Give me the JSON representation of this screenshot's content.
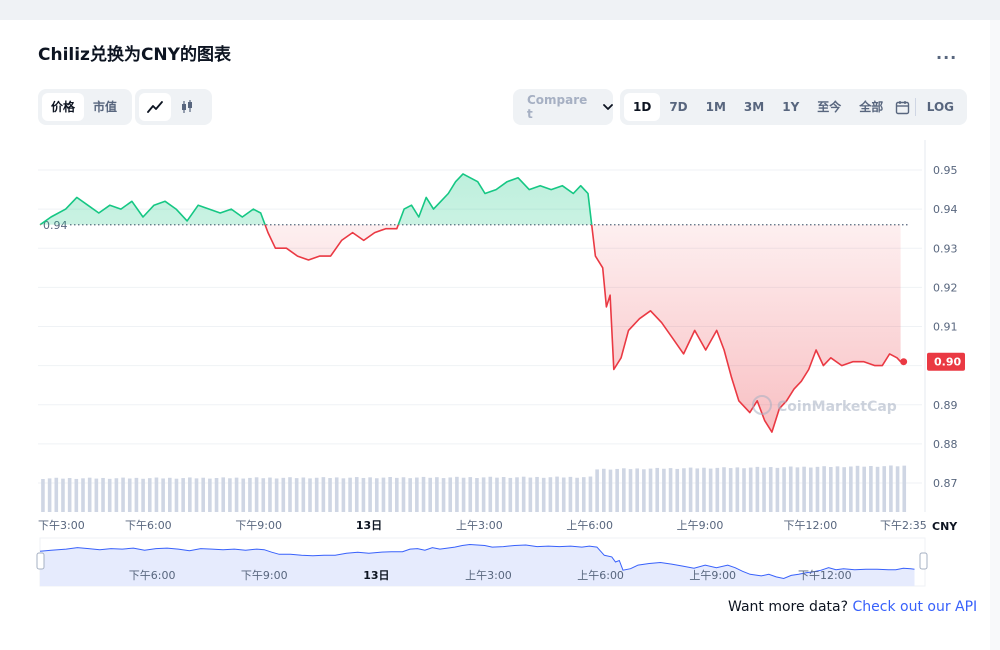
{
  "header": {
    "title": "Chiliz兑换为CNY的图表",
    "more_label": "..."
  },
  "toggle_price_cap": {
    "price_label": "价格",
    "cap_label": "市值"
  },
  "compare": {
    "label": "Compare t"
  },
  "ranges": [
    {
      "label": "1D",
      "active": true
    },
    {
      "label": "7D"
    },
    {
      "label": "1M"
    },
    {
      "label": "3M"
    },
    {
      "label": "1Y"
    },
    {
      "label": "至今"
    },
    {
      "label": "全部"
    }
  ],
  "log_label": "LOG",
  "currency": "CNY",
  "watermark": "CoinMarketCap",
  "footer": {
    "prompt": "Want more data?",
    "link": "Check out our API"
  },
  "colors": {
    "up": "#16c784",
    "down": "#ea3943",
    "grid": "#eff2f5",
    "volume": "#cfd6e4",
    "navigator": "#e6ebfd",
    "navigator_line": "#3861fb"
  },
  "chart_data": {
    "type": "line",
    "open_price": 0.936,
    "open_price_label": "0.94",
    "current_price": 0.901,
    "current_price_label": "0.90",
    "ylim": [
      0.865,
      0.96
    ],
    "yticks": [
      {
        "value": 0.95,
        "label": "0.95"
      },
      {
        "value": 0.94,
        "label": "0.94"
      },
      {
        "value": 0.93,
        "label": "0.93"
      },
      {
        "value": 0.92,
        "label": "0.92"
      },
      {
        "value": 0.91,
        "label": "0.91"
      },
      {
        "value": 0.9,
        "label": "0.90"
      },
      {
        "value": 0.89,
        "label": "0.89"
      },
      {
        "value": 0.88,
        "label": "0.88"
      },
      {
        "value": 0.87,
        "label": "0.87"
      }
    ],
    "xlim": [
      0,
      23.6
    ],
    "xticks": [
      {
        "t": 0,
        "label": "下午3:00"
      },
      {
        "t": 3,
        "label": "下午6:00"
      },
      {
        "t": 6,
        "label": "下午9:00"
      },
      {
        "t": 9,
        "label": "13日"
      },
      {
        "t": 12,
        "label": "上午3:00"
      },
      {
        "t": 15,
        "label": "上午6:00"
      },
      {
        "t": 18,
        "label": "上午9:00"
      },
      {
        "t": 21,
        "label": "下午12:00"
      },
      {
        "t": 23.6,
        "label": "下午2:35"
      }
    ],
    "navigator_xticks": [
      {
        "t": 3,
        "label": "下午6:00"
      },
      {
        "t": 6,
        "label": "下午9:00"
      },
      {
        "t": 9,
        "label": "13日"
      },
      {
        "t": 12,
        "label": "上午3:00"
      },
      {
        "t": 15,
        "label": "上午6:00"
      },
      {
        "t": 18,
        "label": "上午9:00"
      },
      {
        "t": 21,
        "label": "下午12:00"
      }
    ],
    "series": [
      {
        "points": [
          [
            0.0,
            0.936
          ],
          [
            0.3,
            0.938
          ],
          [
            0.7,
            0.94
          ],
          [
            1.0,
            0.943
          ],
          [
            1.3,
            0.941
          ],
          [
            1.6,
            0.939
          ],
          [
            1.9,
            0.941
          ],
          [
            2.2,
            0.94
          ],
          [
            2.5,
            0.942
          ],
          [
            2.8,
            0.938
          ],
          [
            3.1,
            0.941
          ],
          [
            3.4,
            0.942
          ],
          [
            3.7,
            0.94
          ],
          [
            4.0,
            0.937
          ],
          [
            4.3,
            0.941
          ],
          [
            4.6,
            0.94
          ],
          [
            4.9,
            0.939
          ],
          [
            5.2,
            0.94
          ],
          [
            5.5,
            0.938
          ],
          [
            5.8,
            0.94
          ],
          [
            6.0,
            0.939
          ],
          [
            6.2,
            0.934
          ],
          [
            6.4,
            0.93
          ],
          [
            6.7,
            0.93
          ],
          [
            7.0,
            0.928
          ],
          [
            7.3,
            0.927
          ],
          [
            7.6,
            0.928
          ],
          [
            7.9,
            0.928
          ],
          [
            8.2,
            0.932
          ],
          [
            8.5,
            0.934
          ],
          [
            8.8,
            0.932
          ],
          [
            9.1,
            0.934
          ],
          [
            9.4,
            0.935
          ],
          [
            9.7,
            0.935
          ],
          [
            9.9,
            0.94
          ],
          [
            10.1,
            0.941
          ],
          [
            10.3,
            0.938
          ],
          [
            10.5,
            0.943
          ],
          [
            10.7,
            0.94
          ],
          [
            10.9,
            0.942
          ],
          [
            11.1,
            0.944
          ],
          [
            11.3,
            0.947
          ],
          [
            11.5,
            0.949
          ],
          [
            11.7,
            0.948
          ],
          [
            11.9,
            0.947
          ],
          [
            12.1,
            0.944
          ],
          [
            12.4,
            0.945
          ],
          [
            12.7,
            0.947
          ],
          [
            13.0,
            0.948
          ],
          [
            13.3,
            0.945
          ],
          [
            13.6,
            0.946
          ],
          [
            13.9,
            0.945
          ],
          [
            14.2,
            0.946
          ],
          [
            14.5,
            0.944
          ],
          [
            14.7,
            0.946
          ],
          [
            14.8,
            0.945
          ],
          [
            14.9,
            0.944
          ],
          [
            15.0,
            0.936
          ],
          [
            15.1,
            0.928
          ],
          [
            15.3,
            0.925
          ],
          [
            15.4,
            0.915
          ],
          [
            15.5,
            0.918
          ],
          [
            15.6,
            0.899
          ],
          [
            15.8,
            0.902
          ],
          [
            16.0,
            0.909
          ],
          [
            16.3,
            0.912
          ],
          [
            16.6,
            0.914
          ],
          [
            16.9,
            0.911
          ],
          [
            17.2,
            0.907
          ],
          [
            17.5,
            0.903
          ],
          [
            17.8,
            0.909
          ],
          [
            18.1,
            0.904
          ],
          [
            18.4,
            0.909
          ],
          [
            18.6,
            0.904
          ],
          [
            18.8,
            0.897
          ],
          [
            19.0,
            0.891
          ],
          [
            19.3,
            0.888
          ],
          [
            19.5,
            0.891
          ],
          [
            19.7,
            0.886
          ],
          [
            19.9,
            0.883
          ],
          [
            20.1,
            0.889
          ],
          [
            20.3,
            0.891
          ],
          [
            20.5,
            0.894
          ],
          [
            20.7,
            0.896
          ],
          [
            20.9,
            0.899
          ],
          [
            21.1,
            0.904
          ],
          [
            21.3,
            0.9
          ],
          [
            21.5,
            0.902
          ],
          [
            21.8,
            0.9
          ],
          [
            22.1,
            0.901
          ],
          [
            22.4,
            0.901
          ],
          [
            22.7,
            0.9
          ],
          [
            22.9,
            0.9
          ],
          [
            23.1,
            0.903
          ],
          [
            23.3,
            0.902
          ],
          [
            23.4,
            0.901
          ]
        ]
      }
    ]
  }
}
